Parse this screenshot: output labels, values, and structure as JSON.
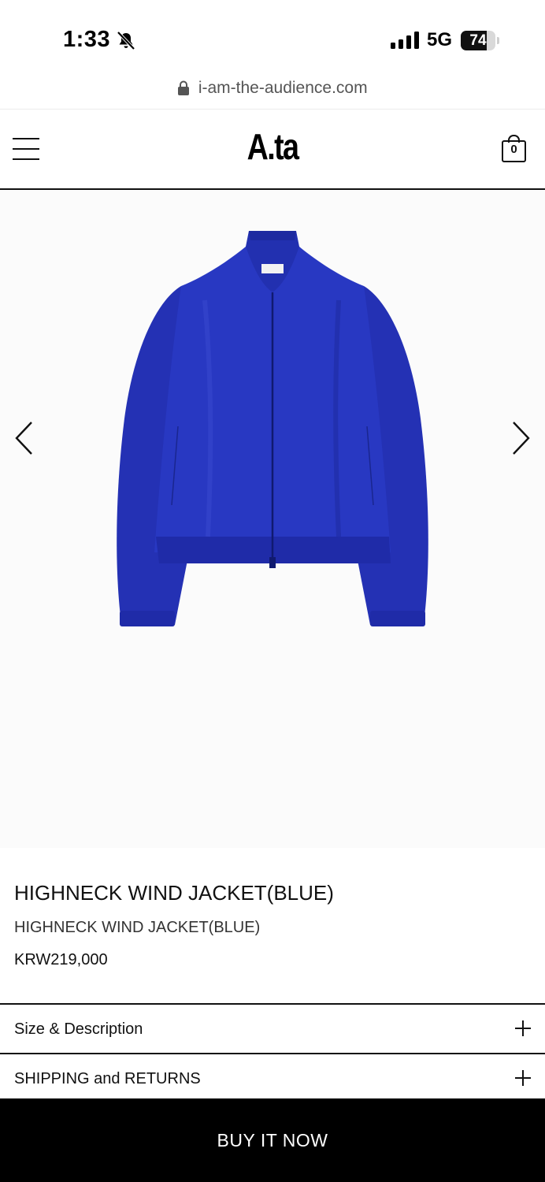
{
  "status_bar": {
    "time": "1:33",
    "network": "5G",
    "battery": 74
  },
  "browser": {
    "url": "i-am-the-audience.com"
  },
  "header": {
    "logo": "A.ta",
    "cart_count": "0"
  },
  "gallery": {
    "image_icon": "blue-jacket-image",
    "jacket_color": "#2631b8"
  },
  "product": {
    "title": "HIGHNECK WIND JACKET(BLUE)",
    "subtitle": "HIGHNECK WIND JACKET(BLUE)",
    "price": "KRW219,000"
  },
  "accordions": [
    {
      "label": "Size & Description"
    },
    {
      "label": "SHIPPING and RETURNS"
    }
  ],
  "cta": {
    "label": "BUY IT NOW"
  }
}
